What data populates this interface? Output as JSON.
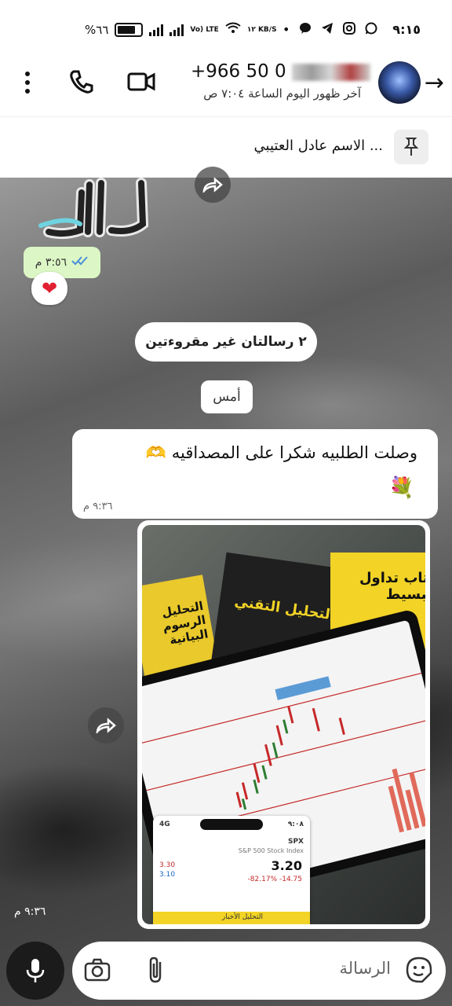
{
  "status_bar": {
    "time": "٩:١٥",
    "battery": "%٦٦",
    "network_volte": "Vo) LTE",
    "speed": "١٢ KB/S"
  },
  "header": {
    "phone_number": "+966 50 0",
    "last_seen": "آخر ظهور اليوم الساعة ٧:٠٤ ص"
  },
  "pinned": {
    "text": "الاسم عادل العتيبي ..."
  },
  "messages": {
    "sticker_time": "٣:٥٦ م",
    "reaction": "❤",
    "unread_banner": "٢ رسالتان غير مقروءتين",
    "date_chip": "أمس",
    "text_message": "وصلت الطلبيه شكرا على المصداقيه 🫶",
    "text_flower": "💐",
    "text_time": "٩:٣٦ م",
    "image_time": "٩:٣٦ م"
  },
  "image_content": {
    "book_center": "التحليل التقني",
    "book_right": "كتاب تداول البسيط",
    "book_left": "التحليل الرسوم البيانية",
    "phone_time": "٩:٠٨",
    "ticker": "SPX",
    "ticker_sub": "S&P 500 Stock Index",
    "price": "3.20",
    "change": "-82.17% -14.75",
    "phone_tabs": "التحليل الأخبار",
    "bid": "3.30",
    "ask": "3.10"
  },
  "composer": {
    "placeholder": "الرسالة"
  },
  "colors": {
    "tick_blue": "#4a90d9",
    "time_badge_bg": "#dcf7c5",
    "heart": "#e02030"
  }
}
